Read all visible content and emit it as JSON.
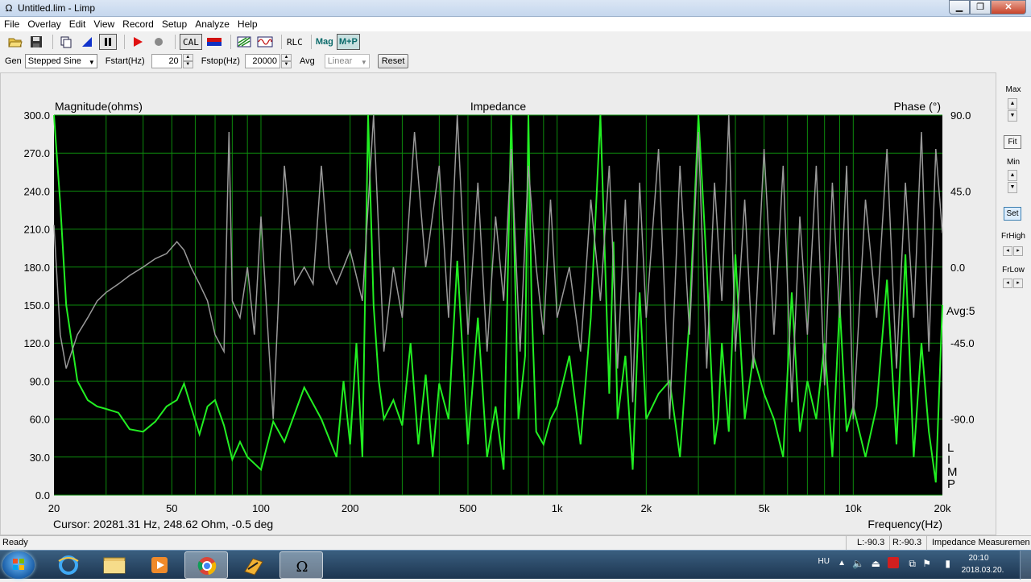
{
  "window": {
    "title": "Untitled.lim - Limp",
    "app_icon": "omega-icon",
    "controls": [
      "_",
      "□",
      "x"
    ]
  },
  "menu": [
    "File",
    "Overlay",
    "Edit",
    "View",
    "Record",
    "Setup",
    "Analyze",
    "Help"
  ],
  "toolbar": {
    "cal": "CAL",
    "rlc": "RLC",
    "mag": "Mag",
    "mp": "M+P"
  },
  "params": {
    "gen_label": "Gen",
    "gen_value": "Stepped Sine",
    "fstart_label": "Fstart(Hz)",
    "fstart_value": "20",
    "fstop_label": "Fstop(Hz)",
    "fstop_value": "20000",
    "avg_label": "Avg",
    "avg_value": "Linear",
    "reset": "Reset"
  },
  "side": {
    "max": "Max",
    "fit": "Fit",
    "min": "Min",
    "set": "Set",
    "frhigh": "FrHigh",
    "frlow": "FrLow"
  },
  "plot": {
    "title": "Impedance",
    "left_label": "Magnitude(ohms)",
    "right_label": "Phase (°)",
    "avg": "Avg:5",
    "limp": [
      "L",
      "I",
      "M",
      "P"
    ],
    "cursor": "Cursor: 20281.31 Hz, 248.62 Ohm, -0.5 deg",
    "freq_label": "Frequency(Hz)"
  },
  "status": {
    "ready": "Ready",
    "l": "L:-90.3",
    "r": "R:-90.3",
    "mode": "Impedance Measuremen"
  },
  "tray": {
    "lang": "HU",
    "time": "20:10",
    "date": "2018.03.20."
  },
  "colors": {
    "magnitude": "#22ee22",
    "phase": "#9a9a9a",
    "grid": "#0d8a0d",
    "background": "#000000"
  },
  "chart_data": {
    "type": "line",
    "title": "Impedance",
    "xlabel": "Frequency(Hz)",
    "ylabel": "Magnitude(ohms)",
    "y2label": "Phase (°)",
    "xscale": "log",
    "xlim": [
      20,
      20000
    ],
    "ylim": [
      0,
      300
    ],
    "y2lim": [
      -135,
      90
    ],
    "xticks": [
      "20",
      "50",
      "100",
      "200",
      "500",
      "1k",
      "2k",
      "5k",
      "10k",
      "20k"
    ],
    "xtick_values": [
      20,
      50,
      100,
      200,
      500,
      1000,
      2000,
      5000,
      10000,
      20000
    ],
    "yticks": [
      "300.0",
      "270.0",
      "240.0",
      "210.0",
      "180.0",
      "150.0",
      "120.0",
      "90.0",
      "60.0",
      "30.0",
      "0.0"
    ],
    "y2ticks": [
      "90.0",
      "45.0",
      "0.0",
      "-45.0",
      "-90.0"
    ],
    "grid": true,
    "series": [
      {
        "name": "Magnitude(ohms)",
        "axis": "left",
        "x": [
          20,
          21,
          22,
          24,
          26,
          28,
          30,
          33,
          36,
          40,
          44,
          48,
          52,
          55,
          58,
          62,
          66,
          70,
          75,
          80,
          85,
          90,
          100,
          110,
          120,
          140,
          160,
          180,
          190,
          200,
          210,
          220,
          230,
          240,
          250,
          260,
          280,
          300,
          320,
          340,
          360,
          380,
          400,
          430,
          460,
          500,
          540,
          580,
          620,
          660,
          700,
          740,
          780,
          800,
          820,
          850,
          900,
          950,
          1000,
          1100,
          1200,
          1300,
          1400,
          1500,
          1550,
          1600,
          1700,
          1800,
          1900,
          2000,
          2200,
          2400,
          2600,
          2800,
          3000,
          3200,
          3400,
          3500,
          3600,
          3800,
          4000,
          4300,
          4600,
          5000,
          5400,
          5800,
          6200,
          6600,
          7000,
          7500,
          8000,
          8500,
          9000,
          9500,
          10000,
          11000,
          12000,
          13000,
          14000,
          15000,
          16000,
          17000,
          18000,
          19000,
          20000
        ],
        "y": [
          300,
          230,
          150,
          90,
          75,
          70,
          68,
          65,
          52,
          50,
          58,
          70,
          75,
          88,
          70,
          48,
          70,
          75,
          55,
          28,
          42,
          30,
          20,
          58,
          42,
          85,
          60,
          30,
          90,
          40,
          120,
          30,
          300,
          150,
          90,
          60,
          75,
          55,
          120,
          40,
          95,
          30,
          88,
          60,
          185,
          40,
          140,
          30,
          70,
          20,
          300,
          60,
          110,
          300,
          150,
          50,
          40,
          60,
          70,
          110,
          40,
          140,
          300,
          80,
          200,
          60,
          110,
          20,
          160,
          60,
          80,
          90,
          30,
          140,
          300,
          180,
          40,
          60,
          120,
          50,
          190,
          60,
          110,
          80,
          60,
          30,
          160,
          50,
          90,
          60,
          120,
          30,
          150,
          50,
          70,
          30,
          70,
          170,
          40,
          190,
          30,
          120,
          50,
          10,
          150
        ]
      },
      {
        "name": "Phase (°)",
        "axis": "right",
        "x": [
          20,
          21,
          22,
          24,
          26,
          28,
          30,
          33,
          36,
          40,
          44,
          48,
          52,
          55,
          58,
          62,
          66,
          70,
          75,
          78,
          80,
          85,
          90,
          95,
          100,
          110,
          120,
          130,
          140,
          150,
          160,
          170,
          180,
          190,
          200,
          220,
          240,
          260,
          280,
          300,
          330,
          360,
          400,
          430,
          460,
          500,
          540,
          580,
          620,
          660,
          700,
          750,
          800,
          850,
          900,
          950,
          1000,
          1100,
          1200,
          1300,
          1400,
          1500,
          1600,
          1700,
          1800,
          1900,
          2000,
          2200,
          2400,
          2600,
          2800,
          3000,
          3200,
          3400,
          3600,
          3800,
          4000,
          4300,
          4600,
          5000,
          5400,
          5800,
          6200,
          6600,
          7000,
          7500,
          8000,
          8500,
          9000,
          9500,
          10000,
          11000,
          12000,
          13000,
          14000,
          15000,
          16000,
          17000,
          18000,
          19000,
          20000
        ],
        "y": [
          25,
          -40,
          -60,
          -40,
          -30,
          -20,
          -15,
          -10,
          -5,
          0,
          5,
          8,
          15,
          10,
          0,
          -10,
          -20,
          -40,
          -50,
          80,
          -20,
          -30,
          0,
          -40,
          30,
          -90,
          60,
          -10,
          0,
          -10,
          60,
          0,
          -10,
          0,
          10,
          -20,
          90,
          -50,
          0,
          -30,
          80,
          0,
          60,
          -30,
          90,
          -40,
          50,
          -50,
          30,
          -20,
          70,
          -50,
          60,
          0,
          -40,
          40,
          -30,
          0,
          -50,
          40,
          -20,
          60,
          -60,
          40,
          -80,
          50,
          -30,
          70,
          -90,
          60,
          -40,
          80,
          -60,
          50,
          -20,
          90,
          -50,
          40,
          -60,
          70,
          -40,
          60,
          -80,
          30,
          -40,
          60,
          -70,
          50,
          -30,
          60,
          -90,
          40,
          -30,
          70,
          -60,
          50,
          -30,
          80,
          -50,
          70,
          20
        ]
      }
    ]
  }
}
